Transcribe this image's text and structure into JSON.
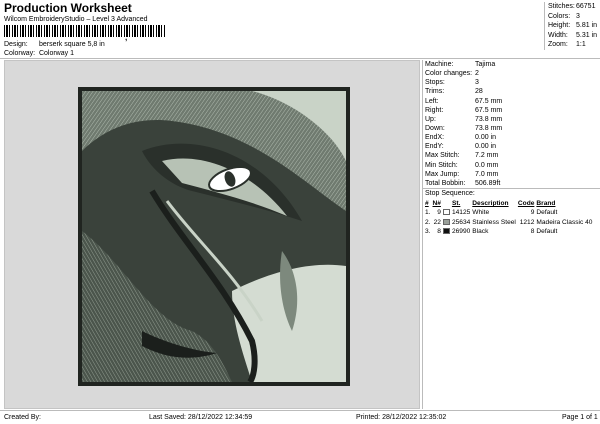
{
  "header": {
    "title": "Production Worksheet",
    "subtitle": "Wilcom EmbroideryStudio – Level 3 Advanced",
    "barcode_mark": ","
  },
  "meta": [
    {
      "label": "Design:",
      "value": "berserk square 5,8 in"
    },
    {
      "label": "Colorway:",
      "value": "Colorway 1"
    }
  ],
  "stats": [
    {
      "label": "Stitches:",
      "value": "66751"
    },
    {
      "label": "Colors:",
      "value": "3"
    },
    {
      "label": "Height:",
      "value": "5.81 in"
    },
    {
      "label": "Width:",
      "value": "5.31 in"
    },
    {
      "label": "Zoom:",
      "value": "1:1"
    }
  ],
  "properties": [
    {
      "label": "Machine:",
      "value": "Tajima"
    },
    {
      "label": "Color changes:",
      "value": "2"
    },
    {
      "label": "Stops:",
      "value": "3"
    },
    {
      "label": "Trims:",
      "value": "28"
    },
    {
      "label": "Left:",
      "value": "67.5 mm"
    },
    {
      "label": "Right:",
      "value": "67.5 mm"
    },
    {
      "label": "Up:",
      "value": "73.8 mm"
    },
    {
      "label": "Down:",
      "value": "73.8 mm"
    },
    {
      "label": "EndX:",
      "value": "0.00 in"
    },
    {
      "label": "EndY:",
      "value": "0.00 in"
    },
    {
      "label": "Max Stitch:",
      "value": "7.2 mm"
    },
    {
      "label": "Min Stitch:",
      "value": "0.0 mm"
    },
    {
      "label": "Max Jump:",
      "value": "7.0 mm"
    },
    {
      "label": "Total Bobbin:",
      "value": "506.89ft"
    }
  ],
  "stop_sequence": {
    "title": "Stop Sequence:",
    "headers": [
      "#",
      "N#",
      "St.",
      "Description",
      "Code",
      "Brand"
    ],
    "rows": [
      {
        "num": "1.",
        "n": "9",
        "color": "#ffffff",
        "st": "14125",
        "desc": "White",
        "code": "9",
        "brand": "Default"
      },
      {
        "num": "2.",
        "n": "22",
        "color": "#9aa09a",
        "st": "25634",
        "desc": "Stainless Steel",
        "code": "1212",
        "brand": "Madeira Classic 40"
      },
      {
        "num": "3.",
        "n": "8",
        "color": "#111111",
        "st": "26990",
        "desc": "Black",
        "code": "8",
        "brand": "Default"
      }
    ]
  },
  "footer": {
    "created": "Created By:",
    "saved": "Last Saved: 28/12/2022 12:34:59",
    "printed": "Printed: 28/12/2022 12:35:02",
    "page": "Page 1 of 1"
  },
  "colors": {
    "thread_light": "#c9d3c7",
    "thread_mid": "#7d897d",
    "thread_dark": "#2a302b",
    "canvas_bg": "#d9d9d9"
  }
}
